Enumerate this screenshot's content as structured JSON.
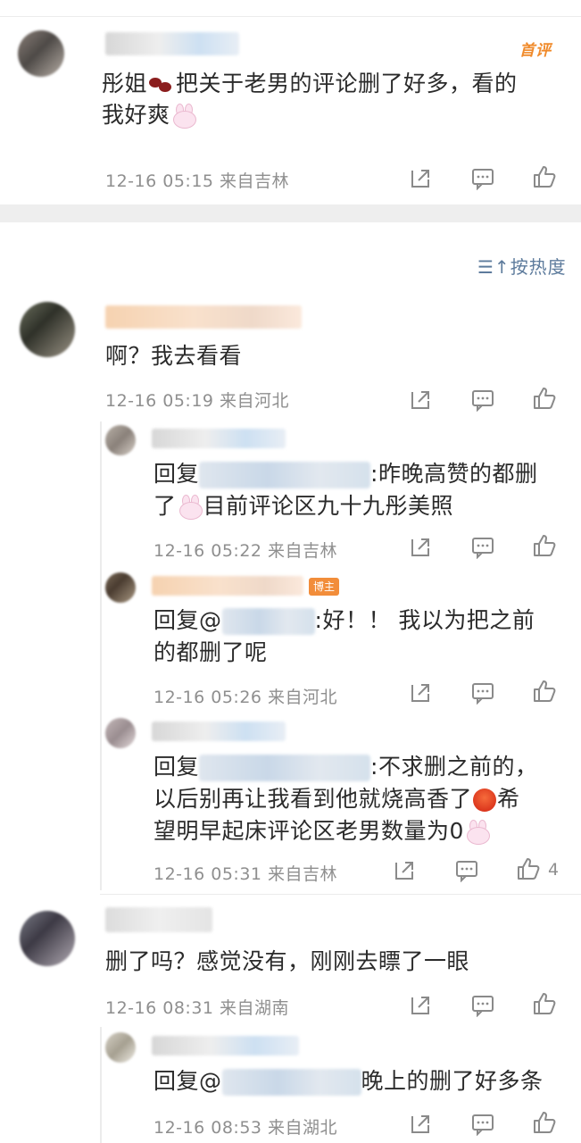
{
  "top_comment": {
    "badge": "首评",
    "text_line1": "彤姐",
    "text_line1_rest": "把关于老男的评论删了好多，看的",
    "text_line2": "我好爽",
    "meta": "12-16 05:15 来自吉林"
  },
  "sort_label": "按热度",
  "comments": [
    {
      "text": "啊？我去看看",
      "meta": "12-16 05:19 来自河北",
      "replies": [
        {
          "prefix": "回复",
          "line1_rest": ":昨晚高赞的都删",
          "line2_a": "了",
          "line2_b": "目前评论区九十九彤美照",
          "meta": "12-16 05:22 来自吉林"
        },
        {
          "prefix": "回复@",
          "badge": "博主",
          "line1_rest": ":好！！ 我以为把之前",
          "line2": "的都删了呢",
          "meta": "12-16 05:26 来自河北"
        },
        {
          "prefix": "回复",
          "line1_rest": ":不求删之前的，",
          "line2": "以后别再让我看到他就烧高香了",
          "line2_after": "希",
          "line3": "望明早起床评论区老男数量为0",
          "meta": "12-16 05:31 来自吉林",
          "like_count": "4"
        }
      ]
    },
    {
      "text": "删了吗？感觉没有，刚刚去瞟了一眼",
      "meta": "12-16 08:31 来自湖南",
      "replies": [
        {
          "prefix": "回复@",
          "line1_rest": "晚上的删了好多条",
          "meta": "12-16 08:53 来自湖北"
        }
      ]
    }
  ],
  "icons": {
    "share": "share-icon",
    "comment": "comment-icon",
    "like": "like-icon",
    "sort": "sort-icon"
  }
}
